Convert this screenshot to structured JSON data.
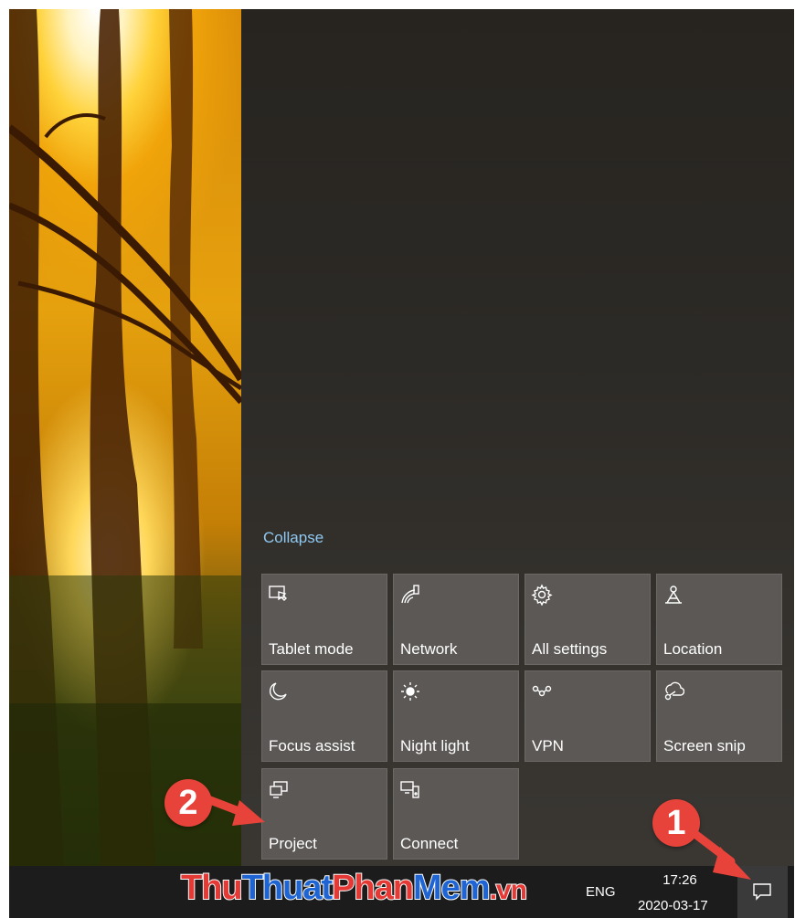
{
  "action_center": {
    "collapse_label": "Collapse",
    "tiles": [
      {
        "label": "Tablet mode",
        "icon": "tablet-mode-icon"
      },
      {
        "label": "Network",
        "icon": "network-icon"
      },
      {
        "label": "All settings",
        "icon": "gear-icon"
      },
      {
        "label": "Location",
        "icon": "location-icon"
      },
      {
        "label": "Focus assist",
        "icon": "moon-icon"
      },
      {
        "label": "Night light",
        "icon": "sun-icon"
      },
      {
        "label": "VPN",
        "icon": "vpn-icon"
      },
      {
        "label": "Screen snip",
        "icon": "screen-snip-icon"
      },
      {
        "label": "Project",
        "icon": "project-icon"
      },
      {
        "label": "Connect",
        "icon": "connect-icon"
      }
    ]
  },
  "taskbar": {
    "language": "ENG",
    "time": "17:26",
    "date": "2020-03-17",
    "action_center_icon": "notification-icon"
  },
  "annotations": {
    "badge_1": "1",
    "badge_2": "2",
    "badge_color": "#e8433a"
  },
  "watermark": {
    "part1": "Thu",
    "part2": "Thuat",
    "part3": "Phan",
    "part4": "Mem",
    "part5": ".vn"
  },
  "colors": {
    "tile_bg": "#5b5855",
    "collapse_link": "#8ec8f2",
    "taskbar_bg": "#1c1c1c"
  }
}
